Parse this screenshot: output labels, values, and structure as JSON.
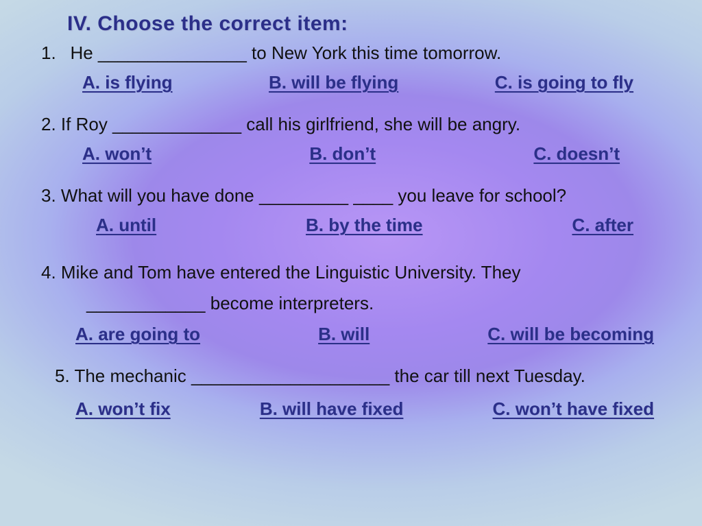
{
  "heading": "IV. Choose the correct item:",
  "questions": [
    {
      "num": "1.",
      "parts": {
        "main": "He _______________ to New York this time tomorrow."
      },
      "options": {
        "a": "A. is flying",
        "b": "B. will be flying",
        "c": "C. is going to fly"
      }
    },
    {
      "num": "2.",
      "parts": {
        "main": "If Roy _____________ call his girlfriend, she will be angry."
      },
      "options": {
        "a": "A. won’t",
        "b": "B. don’t",
        "c": "C. doesn’t"
      }
    },
    {
      "num": "3.",
      "parts": {
        "main": "What will you have done _________ ____ you leave for school?"
      },
      "options": {
        "a": "A. until",
        "b": "B. by the time",
        "c": "C. after"
      }
    },
    {
      "num": "4.",
      "parts": {
        "line1": "Mike and Tom have entered the Linguistic University. They",
        "line2": "____________ become interpreters."
      },
      "options": {
        "a": "A. are going to",
        "b": "B. will",
        "c": "C. will be becoming"
      }
    },
    {
      "num": "5.",
      "parts": {
        "main": "The mechanic ____________________ the car till next Tuesday."
      },
      "options": {
        "a": "A. won’t fix",
        "b": "B. will have fixed",
        "c": "C. won’t have fixed"
      }
    }
  ]
}
